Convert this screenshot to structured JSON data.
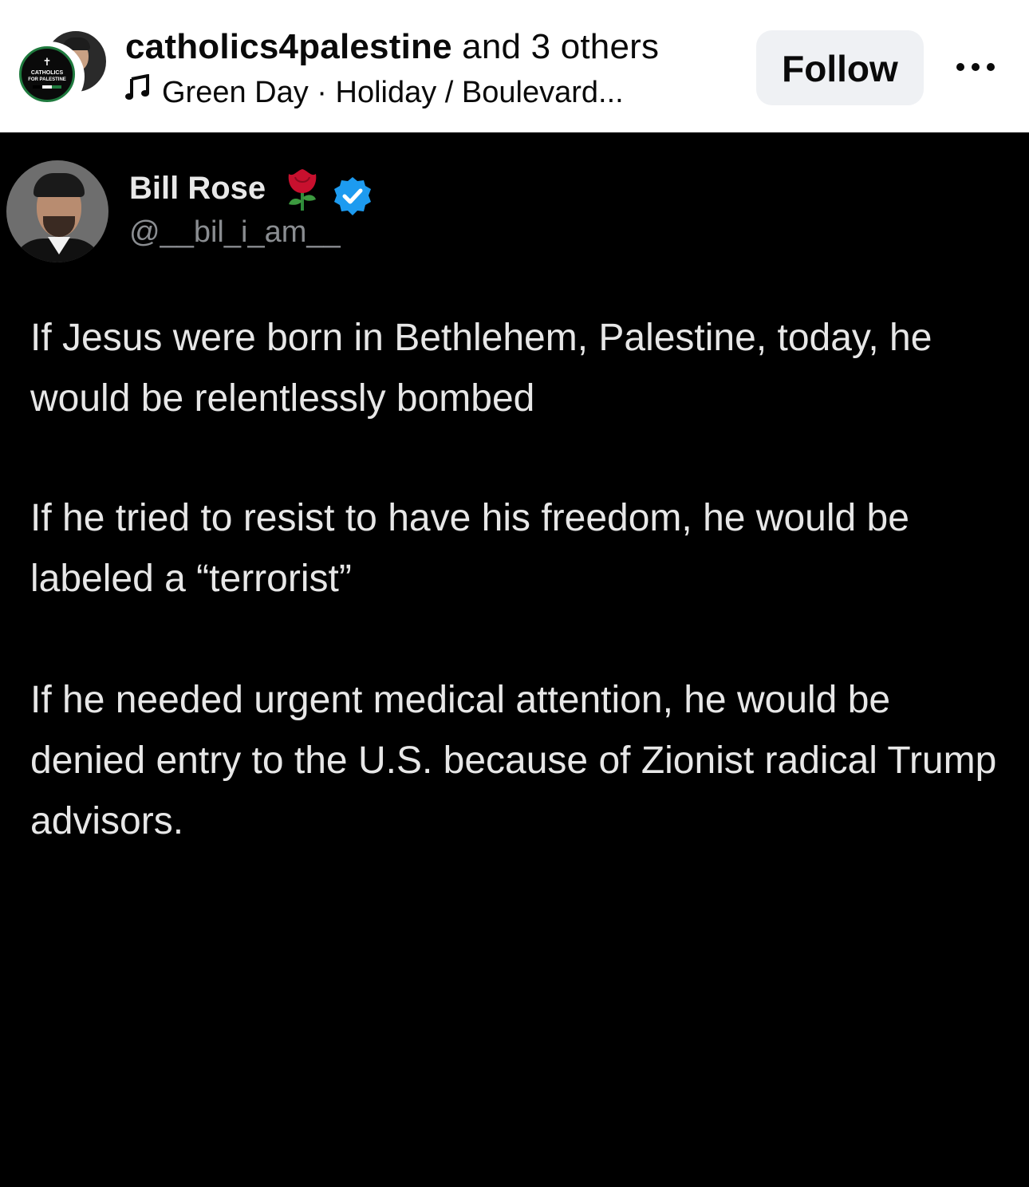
{
  "header": {
    "title_account": "catholics4palestine",
    "title_suffix": " and 3 others",
    "music_text": "Green Day · Holiday / Boulevard...",
    "follow_label": "Follow",
    "avatar_logo": {
      "line1": "CATHOLICS",
      "line2": "FOR PALESTINE"
    }
  },
  "tweet": {
    "name": "Bill Rose",
    "handle": "@__bil_i_am__",
    "paragraphs": [
      "If Jesus were born in Bethlehem, Palestine, today, he would be relentlessly bombed",
      "If he tried to resist to have his freedom, he would be labeled a “terrorist”",
      "If he needed urgent medical attention, he would be denied entry to the U.S. because of Zionist radical Trump advisors."
    ]
  },
  "icons": {
    "music": "music-note-icon",
    "more": "more-options-icon",
    "rose": "rose-icon",
    "verified": "verified-badge-icon"
  },
  "colors": {
    "follow_bg": "#eff1f4",
    "verified_blue": "#1d9bf0",
    "post_bg": "#000000",
    "header_bg": "#ffffff"
  }
}
